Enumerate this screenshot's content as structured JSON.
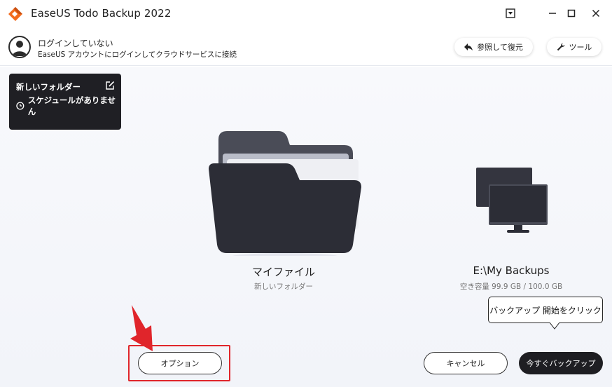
{
  "titlebar": {
    "app_title": "EaseUS Todo Backup 2022",
    "icons": [
      "dropdown-icon",
      "minimize-icon",
      "maximize-icon",
      "close-icon"
    ]
  },
  "header": {
    "user_status": "ログインしていない",
    "user_subtitle": "EaseUS アカウントにログインしてクラウドサービスに接続",
    "browse_restore_label": "参照して復元",
    "tools_label": "ツール"
  },
  "task": {
    "name": "新しいフォルダー",
    "schedule": "スケジュールがありません"
  },
  "source": {
    "name": "マイファイル",
    "subtitle": "新しいフォルダー"
  },
  "destination": {
    "name": "E:\\My Backups",
    "free_space": "空き容量 99.9 GB / 100.0 GB"
  },
  "tooltip": {
    "text": "バックアップ 開始をクリック"
  },
  "buttons": {
    "options": "オプション",
    "cancel": "キャンセル",
    "backup_now": "今すぐバックアップ"
  },
  "colors": {
    "accent_dark": "#1e1e22",
    "highlight_red": "#e0252b",
    "logo_orange": "#f26b1d"
  }
}
